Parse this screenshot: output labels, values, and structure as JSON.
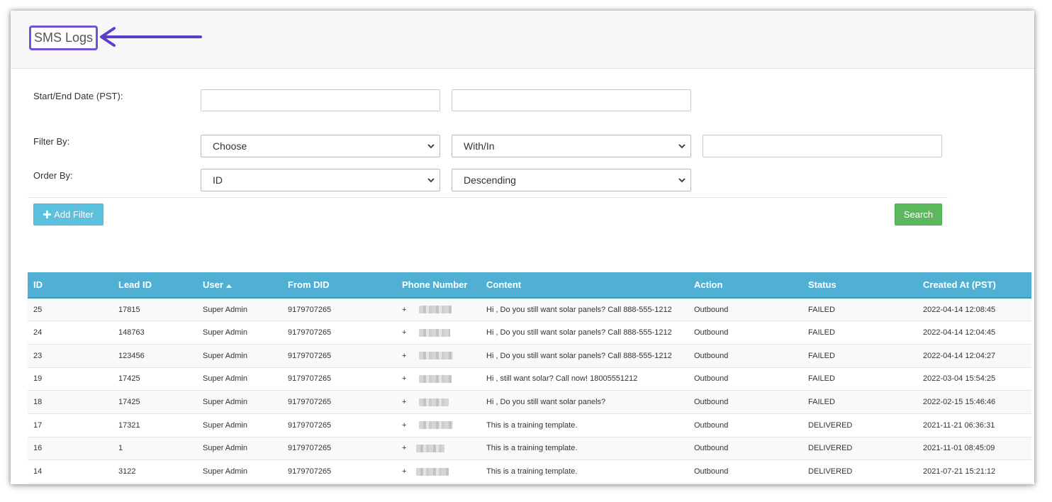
{
  "page": {
    "title": "SMS Logs"
  },
  "filters": {
    "date_label": "Start/End Date (PST):",
    "start_date_value": "",
    "end_date_value": "",
    "filter_by_label": "Filter By:",
    "filter_field_selected": "Choose",
    "filter_operator_selected": "With/In",
    "filter_value": "",
    "order_by_label": "Order By:",
    "order_field_selected": "ID",
    "order_direction_selected": "Descending"
  },
  "buttons": {
    "add_filter_label": "Add Filter",
    "search_label": "Search"
  },
  "table": {
    "headers": {
      "id": "ID",
      "lead_id": "Lead ID",
      "user": "User",
      "from_did": "From DID",
      "phone_number": "Phone Number",
      "content": "Content",
      "action": "Action",
      "status": "Status",
      "created_at": "Created At (PST)"
    },
    "rows": [
      {
        "id": "25",
        "lead_id": "17815",
        "user": "Super Admin",
        "from_did": "9179707265",
        "phone_prefix": "+",
        "content": "Hi , Do you still want solar panels? Call 888-555-1212",
        "action": "Outbound",
        "status": "FAILED",
        "created_at": "2022-04-14 12:08:45"
      },
      {
        "id": "24",
        "lead_id": "148763",
        "user": "Super Admin",
        "from_did": "9179707265",
        "phone_prefix": "+",
        "content": "Hi , Do you still want solar panels? Call 888-555-1212",
        "action": "Outbound",
        "status": "FAILED",
        "created_at": "2022-04-14 12:04:45"
      },
      {
        "id": "23",
        "lead_id": "123456",
        "user": "Super Admin",
        "from_did": "9179707265",
        "phone_prefix": "+",
        "content": "Hi , Do you still want solar panels? Call 888-555-1212",
        "action": "Outbound",
        "status": "FAILED",
        "created_at": "2022-04-14 12:04:27"
      },
      {
        "id": "19",
        "lead_id": "17425",
        "user": "Super Admin",
        "from_did": "9179707265",
        "phone_prefix": "+",
        "content": "Hi , still want solar? Call now! 18005551212",
        "action": "Outbound",
        "status": "FAILED",
        "created_at": "2022-03-04 15:54:25"
      },
      {
        "id": "18",
        "lead_id": "17425",
        "user": "Super Admin",
        "from_did": "9179707265",
        "phone_prefix": "+",
        "content": "Hi , Do you still want solar panels?",
        "action": "Outbound",
        "status": "FAILED",
        "created_at": "2022-02-15 15:46:46"
      },
      {
        "id": "17",
        "lead_id": "17321",
        "user": "Super Admin",
        "from_did": "9179707265",
        "phone_prefix": "+",
        "content": "This is a training template.",
        "action": "Outbound",
        "status": "DELIVERED",
        "created_at": "2021-11-21 06:36:31"
      },
      {
        "id": "16",
        "lead_id": "1",
        "user": "Super Admin",
        "from_did": "9179707265",
        "phone_prefix": "+",
        "content": "This is a training template.",
        "action": "Outbound",
        "status": "DELIVERED",
        "created_at": "2021-11-01 08:45:09"
      },
      {
        "id": "14",
        "lead_id": "3122",
        "user": "Super Admin",
        "from_did": "9179707265",
        "phone_prefix": "+",
        "content": "This is a training template.",
        "action": "Outbound",
        "status": "DELIVERED",
        "created_at": "2021-07-21 15:21:12"
      }
    ]
  },
  "icons": {
    "annotation_arrow": "arrow-left-icon",
    "select_chevron": "chevron-down-icon",
    "add_filter_icon": "plus-icon",
    "sort_indicator": "sort-asc-icon"
  },
  "colors": {
    "annotation": "#7152d8",
    "table_header": "#4fb0d4",
    "info_button": "#5bc0de",
    "success_button": "#5cb85c"
  }
}
